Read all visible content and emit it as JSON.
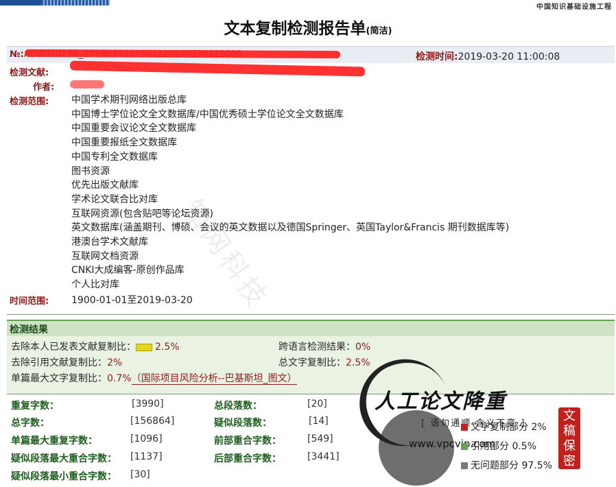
{
  "header": {
    "org": "中国知识基础设施工程",
    "title": "文本复制检测报告单",
    "title_suffix": "(简洁)"
  },
  "meta": {
    "report_no_label": "№:",
    "report_no_value": "ADBD2019R_2019032007501220190320110008",
    "detect_time_label": "检测时间:",
    "detect_time_value": "2019-03-20 11:00:08",
    "doc_label": "检测文献:",
    "author_label": "作者:",
    "scope_label": "检测范围:",
    "scope_items": [
      "中国学术期刊网络出版总库",
      "中国博士学位论文全文数据库/中国优秀硕士学位论文全文数据库",
      "中国重要会议论文全文数据库",
      "中国重要报纸全文数据库",
      "中国专利全文数据库",
      "图书资源",
      "优先出版文献库",
      "学术论文联合比对库",
      "互联网资源(包含贴吧等论坛资源)",
      "英文数据库(涵盖期刊、博硕、会议的英文数据以及德国Springer、英国Taylor&Francis 期刊数据库等)",
      "港澳台学术文献库",
      "互联网文档资源",
      "CNKI大成编客-原创作品库",
      "个人比对库"
    ],
    "time_range_label": "时间范围:",
    "time_range_value": "1900-01-01至2019-03-20"
  },
  "result": {
    "section_title": "检测结果",
    "self_excluded_label": "去除本人已发表文献复制比：",
    "self_excluded_value": "2.5%",
    "cross_lang_label": "跨语言检测结果：",
    "cross_lang_value": "0%",
    "quote_excluded_label": "去除引用文献复制比：",
    "quote_excluded_value": "2%",
    "total_ratio_label": "总文字复制比：",
    "total_ratio_value": "2.5%",
    "single_max_label": "单篇最大文字复制比：",
    "single_max_value": "0.7%",
    "single_max_source": "（国际项目风险分析--巴基斯坦_图文）"
  },
  "stats": {
    "repeat_chars_label": "重复字数：",
    "repeat_chars_value": "[3990]",
    "total_paras_label": "总段落数：",
    "total_paras_value": "[20]",
    "total_chars_label": "总字数：",
    "total_chars_value": "[156864]",
    "suspect_paras_label": "疑似段落数：",
    "suspect_paras_value": "[14]",
    "single_max_repeat_label": "单篇最大重复字数：",
    "single_max_repeat_value": "[1096]",
    "front_overlap_label": "前部重合字数：",
    "front_overlap_value": "[549]",
    "suspect_para_max_label": "疑似段落最大重合字数：",
    "suspect_para_max_value": "[1137]",
    "back_overlap_label": "后部重合字数：",
    "back_overlap_value": "[3441]",
    "suspect_para_min_label": "疑似段落最小重合字数：",
    "suspect_para_min_value": "[30]"
  },
  "legend": {
    "copy_part": "文字复制部分 2%",
    "quote_part": "引用部分 0.5%",
    "ok_part": "无问题部分 97.5%",
    "colors": {
      "copy": "#c0211c",
      "quote": "#6aa05a",
      "ok": "#7a7a7a"
    }
  },
  "overlay": {
    "brand": "人工论文降重",
    "slogan": "[ 语句通顺·含义不变 ]",
    "website": "www.vpcvip.com",
    "seal_text": "文稿保密",
    "watermark": "知网科技"
  }
}
